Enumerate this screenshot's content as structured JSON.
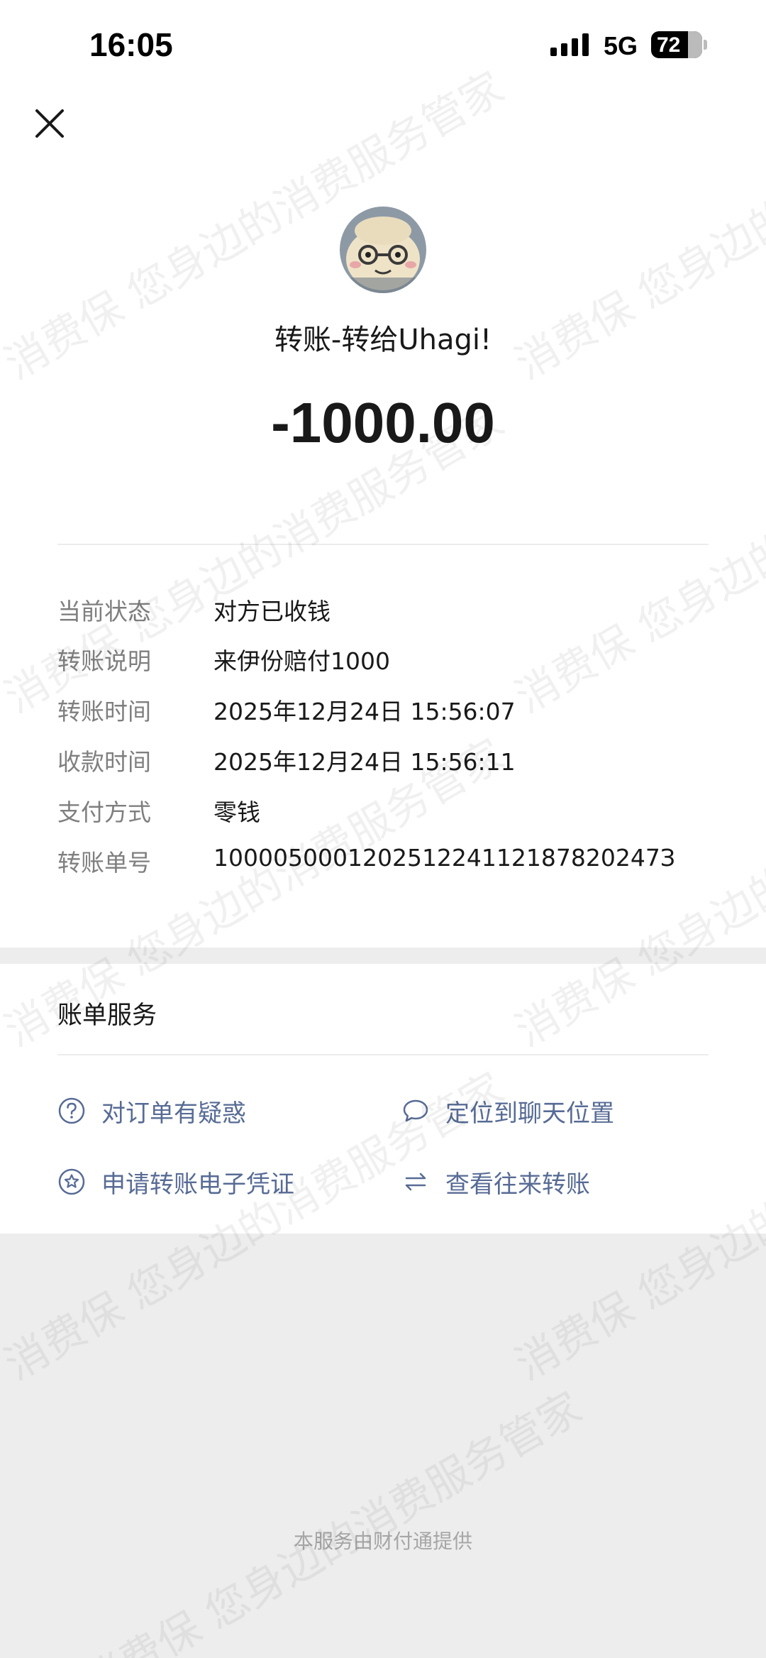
{
  "status_bar": {
    "time": "16:05",
    "network": "5G",
    "battery": "72"
  },
  "header": {
    "title": "转账-转给Uhagi!",
    "amount": "-1000.00"
  },
  "details": [
    {
      "label": "当前状态",
      "value": "对方已收钱"
    },
    {
      "label": "转账说明",
      "value": "来伊份赔付1000"
    },
    {
      "label": "转账时间",
      "value": "2025年12月24日 15:56:07"
    },
    {
      "label": "收款时间",
      "value": "2025年12月24日 15:56:11"
    },
    {
      "label": "支付方式",
      "value": "零钱"
    },
    {
      "label": "转账单号",
      "value": "100005000120251224112187820247З"
    }
  ],
  "services": {
    "heading": "账单服务",
    "items": [
      {
        "label": "对订单有疑惑",
        "icon": "question-circle-icon"
      },
      {
        "label": "定位到聊天位置",
        "icon": "chat-bubble-icon"
      },
      {
        "label": "申请转账电子凭证",
        "icon": "star-badge-icon"
      },
      {
        "label": "查看往来转账",
        "icon": "swap-arrows-icon"
      }
    ]
  },
  "footer": "本服务由财付通提供",
  "watermark": "消费保 您身边的消费服务管家",
  "colors": {
    "link": "#576b95",
    "label": "#7f7f7f",
    "background": "#ededed"
  }
}
